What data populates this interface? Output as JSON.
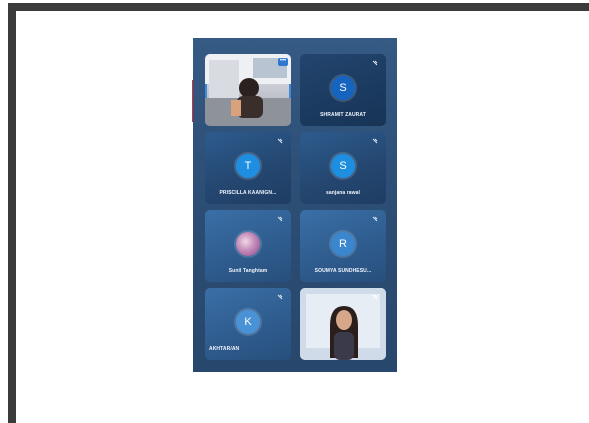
{
  "participants": [
    {
      "name": "",
      "initial": "",
      "type": "video-self"
    },
    {
      "name": "SHRAMIT ZAURAT",
      "initial": "S",
      "type": "avatar"
    },
    {
      "name": "PRISCILLA KAANIGN...",
      "initial": "T",
      "type": "avatar"
    },
    {
      "name": "sanjana rawal",
      "initial": "S",
      "type": "avatar"
    },
    {
      "name": "Sunil Tanghtam",
      "initial": "",
      "type": "photo-avatar"
    },
    {
      "name": "SOUMYA SUNDHESU...",
      "initial": "R",
      "type": "avatar"
    },
    {
      "name": "AKHTAR/AN",
      "initial": "K",
      "type": "avatar"
    },
    {
      "name": "",
      "initial": "",
      "type": "video"
    }
  ],
  "controls": {
    "more_label": "•••"
  },
  "colors": {
    "panel_bg": "#2c4d74",
    "avatar_blue": "#1e8fe0",
    "frame_border": "#3b3b3b"
  },
  "icons": [
    "pin-icon",
    "more-options-icon"
  ]
}
